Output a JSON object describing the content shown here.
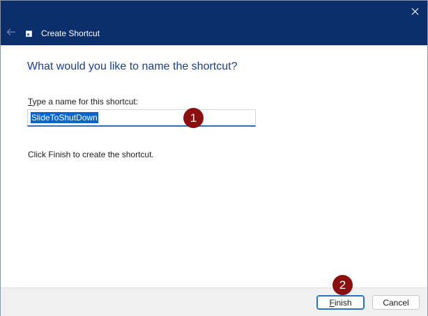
{
  "window": {
    "title": "Create Shortcut",
    "close_label": "✕",
    "back_label": "←"
  },
  "main": {
    "heading": "What would you like to name the shortcut?",
    "field_label_mnemonic": "T",
    "field_label_rest": "ype a name for this shortcut:",
    "name_value": "SlideToShutDown",
    "hint": "Click Finish to create the shortcut."
  },
  "footer": {
    "finish_mnemonic": "F",
    "finish_rest": "inish",
    "cancel_label": "Cancel"
  },
  "annotations": {
    "badge_1": "1",
    "badge_2": "2",
    "badge_color": "#8b0f0f"
  },
  "colors": {
    "titlebar": "#0b2f6b",
    "heading": "#1a3f8f",
    "selection": "#0a64c9",
    "accent": "#2b6fbf"
  }
}
